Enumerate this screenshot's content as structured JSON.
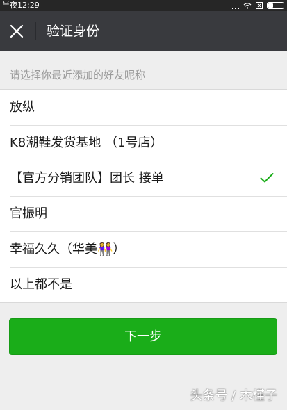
{
  "status_bar": {
    "time": "半夜12:29"
  },
  "nav": {
    "title": "验证身份",
    "close_icon": "close-icon"
  },
  "prompt": "请选择你最近添加的好友昵称",
  "options": [
    {
      "label": "放纵",
      "selected": false
    },
    {
      "label": "K8潮鞋发货基地 （1号店）",
      "selected": false
    },
    {
      "label": "【官方分销团队】团长 接单",
      "selected": true
    },
    {
      "label": "官振明",
      "selected": false
    },
    {
      "label": "幸福久久（华美👭）",
      "selected": false
    },
    {
      "label": "以上都不是",
      "selected": false
    }
  ],
  "next_button": "下一步",
  "watermark": "头条号 / 木槿子",
  "colors": {
    "nav_bg": "#393a3e",
    "accent": "#1aad19",
    "page_bg": "#eeeeee"
  }
}
